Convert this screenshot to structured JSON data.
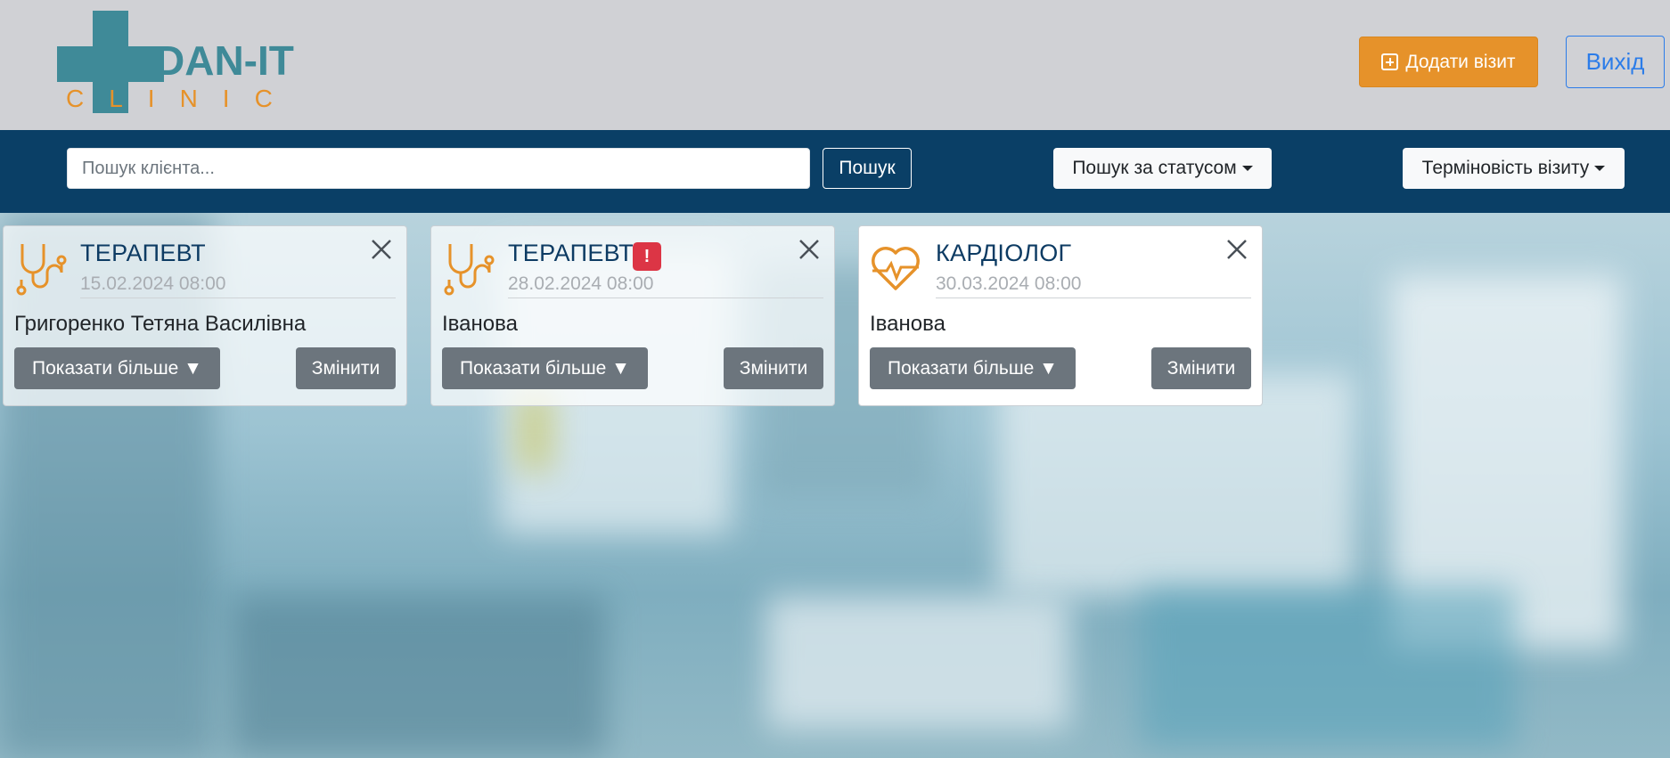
{
  "header": {
    "logo_text_top": "DAN-IT",
    "logo_text_bottom": "CLINIC",
    "add_visit_label": "Додати візит",
    "exit_label": "Вихід"
  },
  "navbar": {
    "search_placeholder": "Пошук клієнта...",
    "search_button": "Пошук",
    "status_dropdown": "Пошук за статусом",
    "urgency_dropdown": "Терміновість візиту"
  },
  "cards": [
    {
      "doctor": "ТЕРАПЕВТ",
      "icon": "stethoscope-icon",
      "urgent_badge": "",
      "datetime": "15.02.2024 08:00",
      "patient": "Григоренко Тетяна Василівна",
      "more_label": "Показати більше ▼",
      "edit_label": "Змінити"
    },
    {
      "doctor": "ТЕРАПЕВТ",
      "icon": "stethoscope-icon",
      "urgent_badge": "!",
      "datetime": "28.02.2024 08:00",
      "patient": "Іванова",
      "more_label": "Показати більше ▼",
      "edit_label": "Змінити"
    },
    {
      "doctor": "КАРДІОЛОГ",
      "icon": "heartbeat-icon",
      "urgent_badge": "",
      "datetime": "30.03.2024 08:00",
      "patient": "Іванова",
      "more_label": "Показати більше ▼",
      "edit_label": "Змінити"
    }
  ],
  "colors": {
    "brand_teal": "#3f8a98",
    "brand_orange": "#e6922a",
    "navbar": "#0a3f66",
    "urgent": "#dc3545"
  }
}
